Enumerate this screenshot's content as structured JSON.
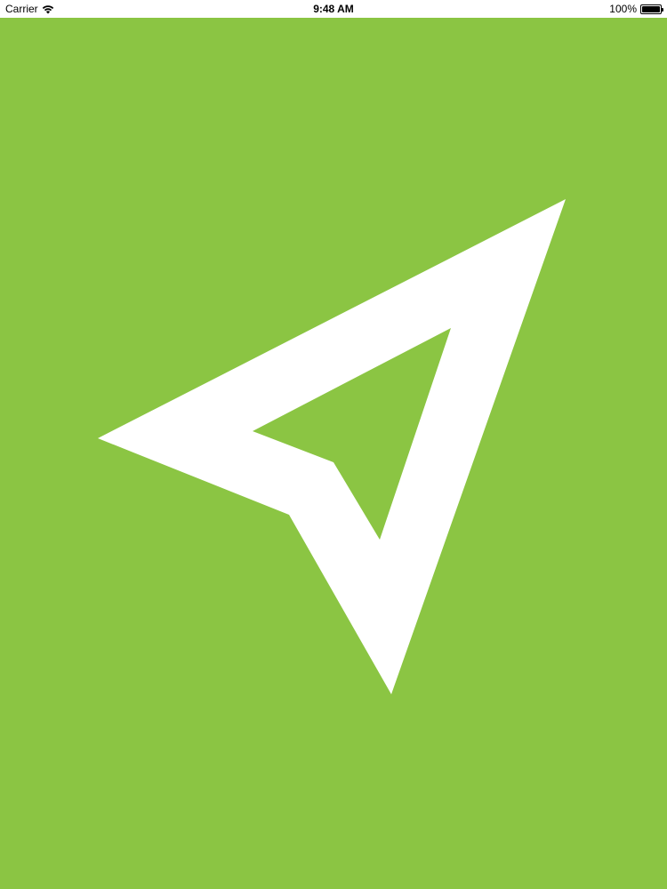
{
  "status_bar": {
    "carrier": "Carrier",
    "wifi_icon": "wifi-icon",
    "time": "9:48 AM",
    "battery_text": "100%",
    "battery_icon": "battery-icon",
    "battery_level": 1.0
  },
  "splash": {
    "background_color": "#8BC543",
    "logo_icon": "navigation-arrow-icon",
    "logo_color": "#FFFFFF"
  }
}
